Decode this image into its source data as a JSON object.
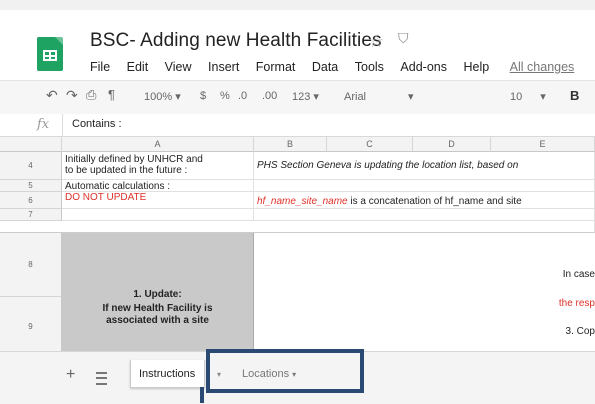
{
  "header": {
    "doc_title": "BSC- Adding new Health Facilities",
    "menu": [
      "File",
      "Edit",
      "View",
      "Insert",
      "Format",
      "Data",
      "Tools",
      "Add-ons",
      "Help"
    ],
    "all_changes": "All changes"
  },
  "toolbar": {
    "zoom": "100%",
    "currency": "$",
    "percent": "%",
    "decimal_less": ".0",
    "decimal_more": ".00",
    "number_format": "123",
    "font": "Arial",
    "font_size": "10",
    "bold": "B"
  },
  "formula_bar": {
    "fx": "fx",
    "value": "Contains :"
  },
  "columns": [
    "A",
    "B",
    "C",
    "D",
    "E"
  ],
  "rows": {
    "r4": {
      "num": "4",
      "a1": "Initially defined by UNHCR and",
      "a2": "to be updated in the future :",
      "b": "PHS Section Geneva is updating the location list, based on"
    },
    "r5": {
      "num": "5",
      "a": "Automatic calculations :"
    },
    "r6": {
      "num": "6",
      "a": "DO NOT UPDATE",
      "b_red": "hf_name_site_name",
      "b_rest": " is a concatenation of hf_name and site"
    },
    "r7": {
      "num": "7"
    },
    "r8": {
      "num": "8"
    },
    "r9": {
      "num": "9"
    }
  },
  "big_cell": {
    "line1": "1. Update:",
    "line2": "If new Health Facility is",
    "line3": "associated with a site"
  },
  "right_block": {
    "line1": "In case",
    "line2": "the resp",
    "line3": "3. Cop"
  },
  "sheet_tabs": {
    "active": "Instructions",
    "inactive": "Locations"
  },
  "colors": {
    "sheets_green": "#1ea362",
    "red_text": "#e0312a",
    "highlight_box": "#2b4a73"
  }
}
